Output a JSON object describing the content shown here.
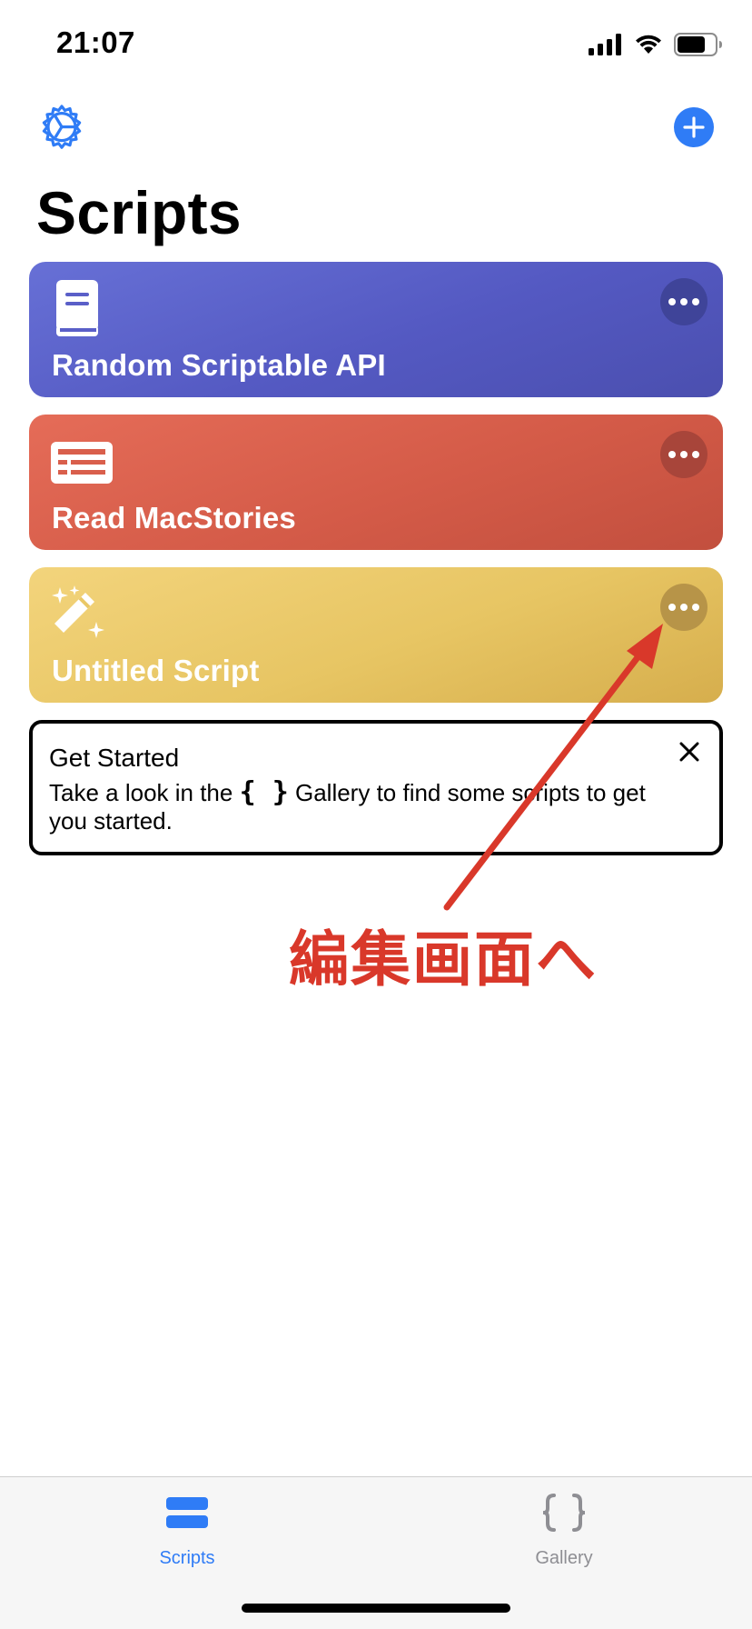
{
  "status_bar": {
    "time": "21:07",
    "icons": [
      "signal-icon",
      "wifi-icon",
      "battery-icon"
    ]
  },
  "toolbar": {
    "settings_icon": "gear-icon",
    "add_icon": "plus-icon"
  },
  "page": {
    "title": "Scripts"
  },
  "scripts": [
    {
      "title": "Random Scriptable API",
      "icon": "book-icon",
      "color": "#5a5fc8"
    },
    {
      "title": "Read MacStories",
      "icon": "newspaper-icon",
      "color": "#d95f4c"
    },
    {
      "title": "Untitled Script",
      "icon": "magic-wand-icon",
      "color": "#e9c867"
    }
  ],
  "get_started": {
    "title": "Get Started",
    "text_before": "Take a look in the ",
    "braces": "{ }",
    "text_after": " Gallery to find some scripts to get you started."
  },
  "annotation": {
    "text": "編集画面へ",
    "color": "#d9382a"
  },
  "tab_bar": {
    "tabs": [
      {
        "label": "Scripts",
        "icon": "stack-icon",
        "active": true
      },
      {
        "label": "Gallery",
        "icon": "braces-icon",
        "active": false
      }
    ],
    "accent": "#2f7cf6"
  }
}
